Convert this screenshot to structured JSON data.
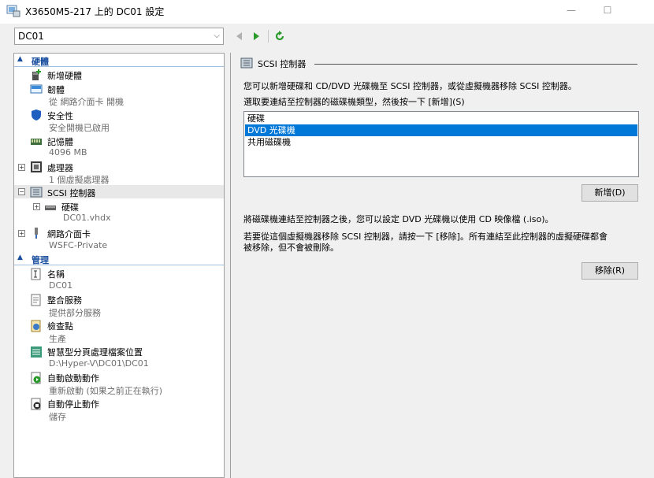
{
  "window": {
    "title": "X3650M5-217 上的 DC01 設定",
    "minimize_glyph": "—",
    "maximize_glyph": "☐"
  },
  "vm_selector": {
    "value": "DC01"
  },
  "sidebar": {
    "hardware_header": "硬體",
    "management_header": "管理",
    "hardware_items": [
      {
        "label": "新增硬體",
        "sub": ""
      },
      {
        "label": "韌體",
        "sub": "從 網路介面卡 開機"
      },
      {
        "label": "安全性",
        "sub": "安全開機已啟用"
      },
      {
        "label": "記憶體",
        "sub": "4096 MB"
      },
      {
        "label": "處理器",
        "sub": "1 個虛擬處理器"
      },
      {
        "label": "SCSI 控制器",
        "sub": ""
      },
      {
        "label": "硬碟",
        "sub": "DC01.vhdx"
      },
      {
        "label": "網路介面卡",
        "sub": "WSFC-Private"
      }
    ],
    "management_items": [
      {
        "label": "名稱",
        "sub": "DC01"
      },
      {
        "label": "整合服務",
        "sub": "提供部分服務"
      },
      {
        "label": "檢查點",
        "sub": "生產"
      },
      {
        "label": "智慧型分頁處理檔案位置",
        "sub": "D:\\Hyper-V\\DC01\\DC01"
      },
      {
        "label": "自動啟動動作",
        "sub": "重新啟動 (如果之前正在執行)"
      },
      {
        "label": "自動停止動作",
        "sub": "儲存"
      }
    ]
  },
  "panel": {
    "title": "SCSI 控制器",
    "intro": "您可以新增硬碟和 CD/DVD 光碟機至 SCSI 控制器，或從虛擬機器移除 SCSI 控制器。",
    "choose": "選取要連結至控制器的磁碟機類型，然後按一下 [新增](S)",
    "drive_types": [
      "硬碟",
      "DVD 光碟機",
      "共用磁碟機"
    ],
    "selected_index": 1,
    "add_button": "新增(D)",
    "after_text": "將磁碟機連結至控制器之後，您可以設定 DVD 光碟機以使用 CD 映像檔 (.iso)。",
    "remove_text_1": "若要從這個虛擬機器移除 SCSI 控制器，請按一下 [移除]。所有連結至此控制器的虛擬硬碟都會",
    "remove_text_2": "被移除，但不會被刪除。",
    "remove_button": "移除(R)"
  },
  "colors": {
    "accent": "#0078d7",
    "section_header": "#1a4fa0",
    "nav_green": "#2a9a2a"
  }
}
